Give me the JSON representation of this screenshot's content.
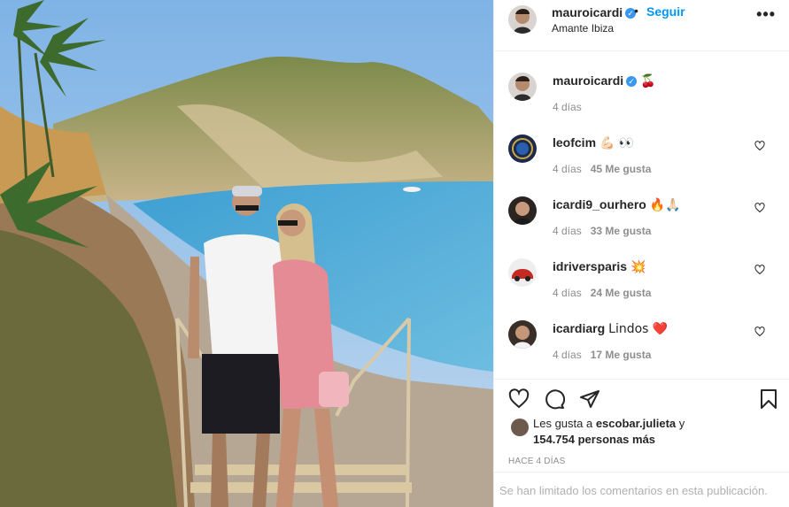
{
  "post": {
    "username": "mauroicardi",
    "verified_mark": "✓",
    "separator": "•",
    "follow_label": "Seguir",
    "location": "Amante Ibiza",
    "more_icon": "more-dots-icon",
    "more_label": "•••",
    "caption": {
      "username": "mauroicardi",
      "text": "🍒",
      "time": "4 días"
    }
  },
  "comments": [
    {
      "username": "leofcim",
      "text": "💪🏻 👀",
      "time": "4 días",
      "likes": "45 Me gusta",
      "avatar_color": "#1e2a4a"
    },
    {
      "username": "icardi9_ourhero",
      "text": "🔥🙏🏻",
      "time": "4 días",
      "likes": "33 Me gusta",
      "avatar_color": "#2b2420"
    },
    {
      "username": "idriversparis",
      "text": "💥",
      "time": "4 días",
      "likes": "24 Me gusta",
      "avatar_color": "#c22a22"
    },
    {
      "username": "icardiarg",
      "text": "Lindos ❤️",
      "time": "4 días",
      "likes": "17 Me gusta",
      "avatar_color": "#3a2e28"
    }
  ],
  "actions": {
    "like_icon": "heart-icon",
    "comment_icon": "comment-icon",
    "share_icon": "share-icon",
    "save_icon": "bookmark-icon"
  },
  "likes": {
    "prefix": "Les gusta a ",
    "user": "escobar.julieta",
    "suffix": " y",
    "others": "154.754 personas más"
  },
  "posted_ago": "HACE 4 DÍAS",
  "comments_limited": "Se han limitado los comentarios en esta publicación.",
  "colors": {
    "accent": "#0095f6",
    "verified": "#3897f0",
    "meta": "#8e8e8e"
  }
}
